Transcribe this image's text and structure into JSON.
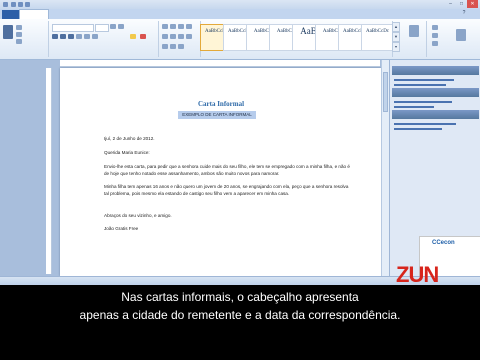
{
  "window": {
    "title": "",
    "minimize_glyph": "–",
    "maximize_glyph": "□",
    "close_glyph": "✕"
  },
  "ribbon": {
    "tabs": [
      {
        "label": ""
      },
      {
        "label": ""
      },
      {
        "label": ""
      },
      {
        "label": ""
      },
      {
        "label": ""
      },
      {
        "label": ""
      }
    ],
    "styles": [
      {
        "sample": "AaBbCcDc",
        "name": ""
      },
      {
        "sample": "AaBbCcDc",
        "name": ""
      },
      {
        "sample": "AaBbCc",
        "name": ""
      },
      {
        "sample": "AaBbCc",
        "name": ""
      },
      {
        "sample": "AaB",
        "name": ""
      },
      {
        "sample": "AaBbCc",
        "name": ""
      },
      {
        "sample": "AaBbCcDc",
        "name": ""
      },
      {
        "sample": "AaBbCcDc",
        "name": ""
      }
    ]
  },
  "document": {
    "title": "Carta Informal",
    "subtitle": "EXEMPLO DE CARTA INFORMAL",
    "date_line": "Ijuí, 2 de Junho de 2012.",
    "greeting": "Querida Maria Eunice:",
    "paragraph1": "Envio-lhe esta carta, para pedir que a senhora cuide mais do seu filho, ele tem se empregado com a minha filha, e não é de hoje que tenho notado esse assanhamento, ambos são muito novos para namorar.",
    "paragraph2": "Minha filha tem apenas 16 anos e não quero um jovem de 20 anos, se engrajando com ela, peço que a senhora resolva tal problema, pois mesmo ela estando de castigo seu filho vem a aparecer em minha casa.",
    "closing": "Abraços do seu vizinho, e amigo.",
    "signature": "João Gratis Free"
  },
  "task_pane": {
    "sections": [
      {
        "heading": ""
      },
      {
        "heading": ""
      },
      {
        "heading": ""
      }
    ]
  },
  "ad": {
    "logo": "CCecon",
    "text": ""
  },
  "status_bar": {
    "page": "",
    "words": "",
    "language": ""
  },
  "watermark": {
    "text": "ZUN"
  },
  "caption": {
    "line1": "Nas cartas informais, o cabeçalho apresenta",
    "line2": "apenas a cidade do remetente e a data da correspondência."
  }
}
